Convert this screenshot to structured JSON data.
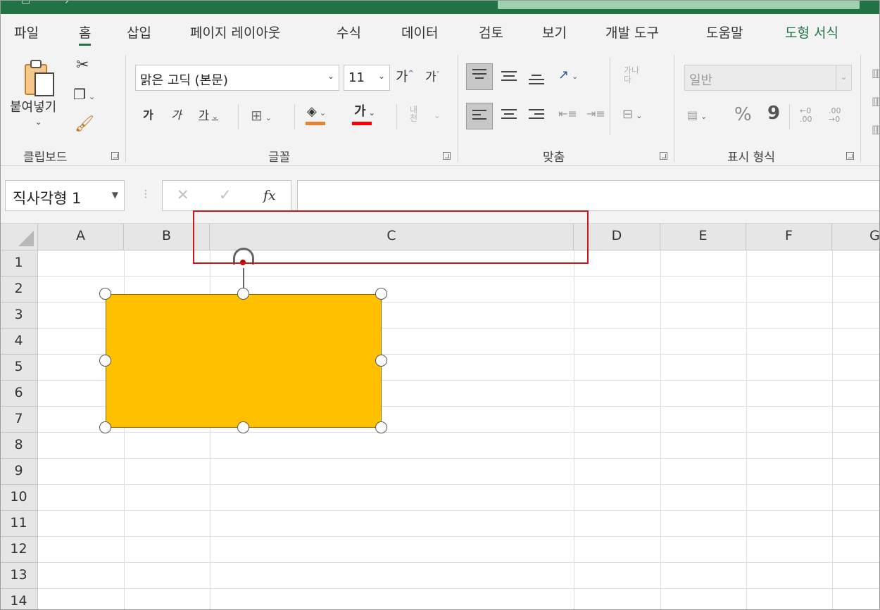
{
  "tabs": [
    {
      "label": "파일"
    },
    {
      "label": "홈",
      "active": true
    },
    {
      "label": "삽입"
    },
    {
      "label": "페이지 레이아웃"
    },
    {
      "label": "수식"
    },
    {
      "label": "데이터"
    },
    {
      "label": "검토"
    },
    {
      "label": "보기"
    },
    {
      "label": "개발 도구"
    },
    {
      "label": "도움말"
    },
    {
      "label": "도형 서식",
      "contextual": true
    }
  ],
  "ribbon": {
    "clipboard": {
      "paste_label": "붙여넣기",
      "group_label": "클립보드"
    },
    "font": {
      "font_name": "맑은 고딕 (본문)",
      "font_size": "11",
      "grow_label": "가",
      "shrink_label": "가",
      "bold_label": "가",
      "italic_label": "가",
      "underline_label": "가",
      "font_color_label": "가",
      "phonetic_label": "내천",
      "group_label": "글꼴"
    },
    "alignment": {
      "wrap_label": "가나\n다",
      "group_label": "맞춤"
    },
    "number": {
      "format": "일반",
      "percent": "%",
      "comma": "9",
      "increase_decimal": ".00",
      "decrease_decimal": ".00",
      "group_label": "표시 형식"
    }
  },
  "formula_bar": {
    "name_box": "직사각형 1",
    "fx_label": "fx",
    "formula": ""
  },
  "sheet": {
    "columns": [
      "A",
      "B",
      "C",
      "D",
      "E",
      "F",
      "G"
    ],
    "rows": [
      "1",
      "2",
      "3",
      "4",
      "5",
      "6",
      "7",
      "8",
      "9",
      "10",
      "11",
      "12",
      "13",
      "14"
    ],
    "shape": {
      "type": "rectangle",
      "fill": "#ffc000",
      "selected": true
    }
  },
  "colors": {
    "accent": "#217346",
    "highlight": "#d0141c",
    "font_color": "#ff0000",
    "fill_color": "#ed7d31"
  }
}
